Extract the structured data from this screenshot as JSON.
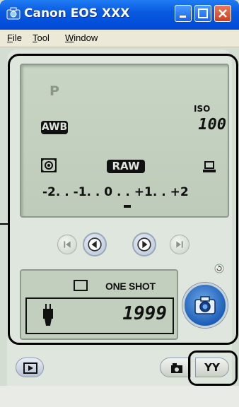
{
  "window": {
    "title": "Canon EOS XXX",
    "buttons": {
      "minimize": "minimize-icon",
      "maximize": "maximize-icon",
      "close": "close-icon"
    }
  },
  "menu": {
    "items": [
      {
        "label": "File",
        "accel": "F",
        "rest": "ile"
      },
      {
        "label": "Tool",
        "accel": "T",
        "rest": "ool"
      },
      {
        "label": "Window",
        "accel": "W",
        "rest": "indow"
      }
    ]
  },
  "lcd": {
    "mode": "P",
    "iso_label": "ISO",
    "iso_value": "100",
    "white_balance": "AWB",
    "quality": "RAW",
    "exposure_scale": "-2. . -1. . 0 . . +1. . +2",
    "icons": [
      "metering-icon",
      "pc-connection-icon"
    ]
  },
  "playback": {
    "icons": [
      "first-image-icon",
      "previous-image-icon",
      "next-image-icon",
      "last-image-icon"
    ]
  },
  "info": {
    "drive_mode_icon": "single-shot-icon",
    "af_mode": "ONE SHOT",
    "shots_remaining": "1999",
    "battery_icon": "battery-icon"
  },
  "bottom": {
    "preferences_label": "YY",
    "icons": [
      "slideshow-icon",
      "camera-settings-icon",
      "rotate-icon",
      "capture-icon"
    ]
  },
  "colors": {
    "titlebar": "#0a5ae0",
    "lcd_background": "#c9d5c4",
    "capture_button": "#1d5fb8"
  }
}
